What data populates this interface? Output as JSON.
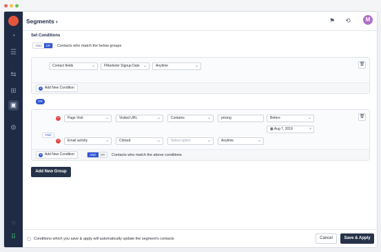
{
  "header": {
    "title": "Segments ›",
    "avatar_initial": "M"
  },
  "section_title": "Set Conditions",
  "and_label": "AND",
  "or_label": "OR",
  "group1": {
    "match_text": "Contacts who match the below groups",
    "row": {
      "field_type": "Contact fields",
      "field": "FMarketer Signup Date",
      "time": "Anytime"
    },
    "add_condition": "Add New Condition"
  },
  "or_pill": "OR",
  "group2": {
    "row1": {
      "field_type": "Page Visit",
      "field": "Visited URL",
      "operator": "Contains",
      "value": "pricing",
      "time": "Before",
      "date": "Aug 7, 2019"
    },
    "and_tag": "AND",
    "row2": {
      "field_type": "Email activity",
      "field": "Clicked",
      "option_placeholder": "Select option",
      "time": "Anytime"
    },
    "add_condition": "Add New Condition",
    "match_text": "Contacts who match the above conditions"
  },
  "add_group": "Add New Group",
  "footer": {
    "note": "Conditions which you save & apply will automatically update the segment's contacts",
    "cancel": "Cancel",
    "save": "Save & Apply"
  },
  "colors": {
    "sidebar": "#1f2a44",
    "accent": "#2f55d4",
    "remove": "#e04848",
    "logo": "#e4563a"
  }
}
